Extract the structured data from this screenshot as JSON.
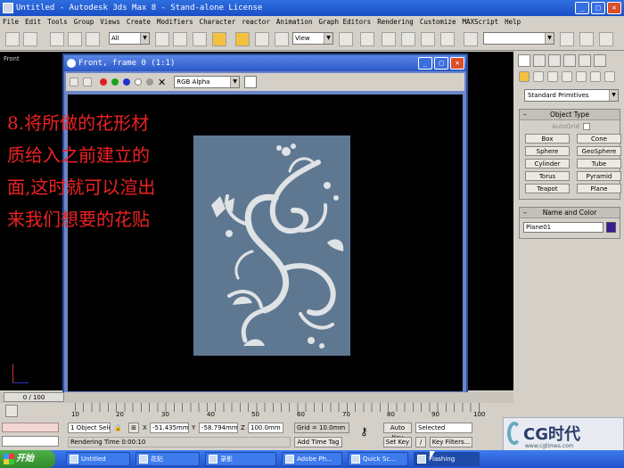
{
  "window": {
    "title": "Untitled - Autodesk 3ds Max 8 - Stand-alone License"
  },
  "menu": [
    "File",
    "Edit",
    "Tools",
    "Group",
    "Views",
    "Create",
    "Modifiers",
    "Character",
    "reactor",
    "Animation",
    "Graph Editors",
    "Rendering",
    "Customize",
    "MAXScript",
    "Help"
  ],
  "toolbar": {
    "selection_filter": "All",
    "ref_coord": "View"
  },
  "viewport": {
    "label": "Front"
  },
  "render_window": {
    "title": "Front, frame 0 (1:1)",
    "channel": "RGB Alpha"
  },
  "caption": {
    "lines": [
      "8.将所做的花形材",
      "质给入之前建立的",
      "面,这时就可以渲出",
      "来我们想要的花贴"
    ]
  },
  "command_panel": {
    "category": "Standard Primitives",
    "object_type": {
      "header": "Object Type",
      "autogrid": "AutoGrid",
      "buttons": [
        "Box",
        "Cone",
        "Sphere",
        "GeoSphere",
        "Cylinder",
        "Tube",
        "Torus",
        "Pyramid",
        "Teapot",
        "Plane"
      ]
    },
    "name_color": {
      "header": "Name and Color",
      "name": "Plane01"
    }
  },
  "time_slider": {
    "label": "0 / 100"
  },
  "trackbar": {
    "ticks": [
      "10",
      "20",
      "30",
      "40",
      "50",
      "60",
      "70",
      "80",
      "90",
      "100"
    ]
  },
  "status": {
    "selection": "1 Object Sele",
    "x_value": "-51.435mm",
    "y_value": "-58.794mm",
    "z_value": "100.0mm",
    "grid": "Grid = 10.0mm",
    "prompt": "Rendering Time 0:00:10",
    "add_time_tag": "Add Time Tag",
    "auto_key": "Auto Key",
    "key_mode": "Selected",
    "set_key": "Set Key",
    "key_filters": "Key Filters..."
  },
  "watermark": {
    "text": "CG时代",
    "url": "www.cgtimes.com"
  },
  "taskbar": {
    "start": "开始",
    "items": [
      "Untitled",
      "花贴",
      "录影",
      "Adobe Ph...",
      "Quick Sc...",
      "Flashing"
    ]
  },
  "colors": {
    "titlebar": "#2f6fe0",
    "caption_text": "#e22222",
    "plane_surface": "#5f7891",
    "flower_pattern": "#dfe3e6"
  }
}
